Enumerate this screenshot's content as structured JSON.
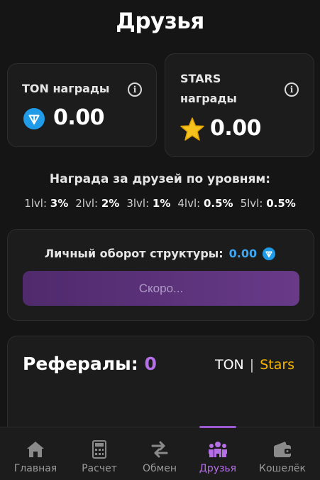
{
  "page": {
    "title": "Друзья"
  },
  "rewards": {
    "ton": {
      "label": "TON награды",
      "amount": "0.00"
    },
    "stars": {
      "label_line1": "STARS",
      "label_line2": "награды",
      "amount": "0.00"
    }
  },
  "levels": {
    "title": "Награда за друзей по уровням:",
    "items": [
      {
        "key": "1lvl:",
        "value": "3%"
      },
      {
        "key": "2lvl:",
        "value": "2%"
      },
      {
        "key": "3lvl:",
        "value": "1%"
      },
      {
        "key": "4lvl:",
        "value": "0.5%"
      },
      {
        "key": "5lvl:",
        "value": "0.5%"
      }
    ]
  },
  "turnover": {
    "label": "Личный оборот структуры:",
    "value": "0.00",
    "button_label": "Скоро..."
  },
  "referrals": {
    "title": "Рефералы:",
    "count": "0",
    "toggle_ton": "TON",
    "toggle_separator": "|",
    "toggle_stars": "Stars"
  },
  "nav": {
    "items": [
      {
        "label": "Главная",
        "icon": "home-icon"
      },
      {
        "label": "Расчет",
        "icon": "calculator-icon"
      },
      {
        "label": "Обмен",
        "icon": "exchange-icon"
      },
      {
        "label": "Друзья",
        "icon": "friends-icon",
        "active": true
      },
      {
        "label": "Кошелёк",
        "icon": "wallet-icon"
      }
    ]
  },
  "colors": {
    "background": "#151515",
    "card": "#1c1c1c",
    "accent_purple": "#b570e8",
    "ton_blue": "#3ea6f2",
    "stars_gold": "#f5b400"
  }
}
